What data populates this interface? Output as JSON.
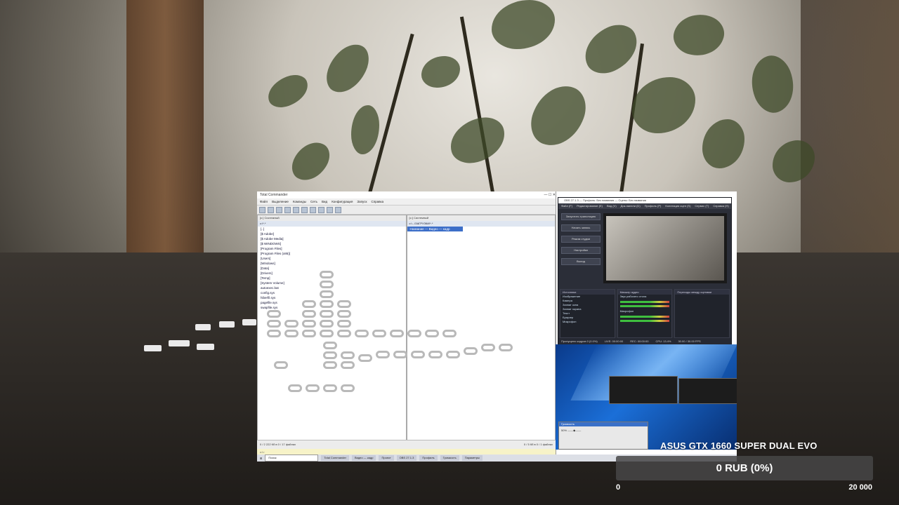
{
  "tc": {
    "title": "Total Commander",
    "menu": [
      "Файл",
      "Выделение",
      "Команды",
      "Сеть",
      "Вид",
      "Конфигурация",
      "Запуск",
      "Справка"
    ],
    "left_drive": "[c:] Системный",
    "left_path": "c:\\*.*",
    "right_drive": "[c:] Системный",
    "right_path": "c:\\...\\ЗАГРУЗКИ\\*.*",
    "left_files": [
      "[..]",
      "[$ Adobe]",
      "[$ Adobe Media]",
      "[$ WINDOWS]",
      "[Program Files]",
      "[Program Files (x86)]",
      "[Users]",
      "[Windows]",
      "[Data]",
      "[Drivers]",
      "[Temp]",
      "[System Volume]",
      "autoexec.bat",
      "config.sys",
      "hiberfil.sys",
      "pagefile.sys",
      "swapfile.sys"
    ],
    "right_files": [
      "Название — Видео — кадр"
    ],
    "status_left": "0 / 2 222 Кб в 0 / 17 файлах",
    "status_right": "0 / 5 Кб в 0 / 1 файлах",
    "cmdline": "c:\\>"
  },
  "obs": {
    "title": "OBS 27.1.3 — Профиль: Без названия — Сцены: Без названия",
    "menu": [
      "Файл (F)",
      "Редактирование (E)",
      "Вид (V)",
      "Док-панели (D)",
      "Профиль (P)",
      "Коллекция сцен (S)",
      "Сервис (T)",
      "Справка (H)"
    ],
    "side_buttons": [
      "Запустить трансляцию",
      "Начать запись",
      "Режим студии",
      "Настройки",
      "Выход"
    ],
    "docks": {
      "sources": "Источники",
      "mixer": "Микшер аудио",
      "transitions": "Переходы между сценами"
    },
    "sources_list": [
      "Изображение",
      "Камера",
      "Захват окна",
      "Захват экрана",
      "Текст",
      "Браузер",
      "Микрофон"
    ],
    "mixer_tracks": [
      "Звук рабочего стола",
      "Микрофон"
    ],
    "status": [
      "Пропущено кадров 0 (0.0%)",
      "LIVE: 00:00:00",
      "REC: 00:00:00",
      "CPU: 13.4%",
      "30.00 / 30.00 FPS"
    ]
  },
  "volume": {
    "title": "Громкость",
    "level": "50%"
  },
  "taskbar": {
    "search": "Поиск",
    "items": [
      "Total Commander",
      "Видео — кадр",
      "Проект",
      "OBS 27.1.3",
      "Профиль",
      "Громкость",
      "Параметры"
    ]
  },
  "donation": {
    "goal_title": "ASUS GTX 1660 SUPER DUAL EVO",
    "amount_text": "0 RUB (0%)",
    "min_label": "0",
    "max_label": "20 000",
    "progress": 0,
    "fill_color": "#3fa34d"
  }
}
